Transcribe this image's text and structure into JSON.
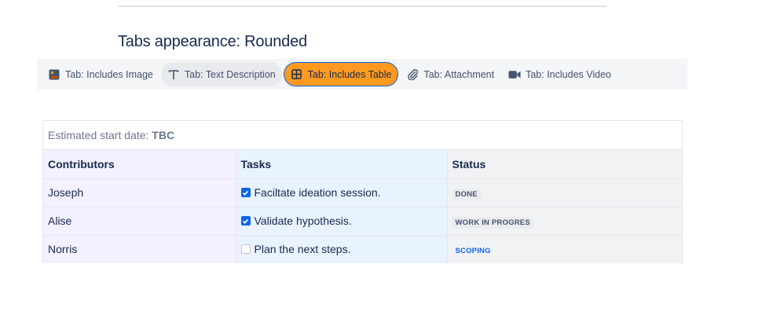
{
  "heading": "Tabs appearance: Rounded",
  "tabs": [
    {
      "label": "Tab: Includes Image",
      "icon": "image-icon"
    },
    {
      "label": "Tab: Text Description",
      "icon": "text-icon"
    },
    {
      "label": "Tab: Includes Table",
      "icon": "table-icon"
    },
    {
      "label": "Tab: Attachment",
      "icon": "paperclip-icon"
    },
    {
      "label": "Tab: Includes Video",
      "icon": "video-icon"
    }
  ],
  "active_tab": "Tab: Includes Table",
  "panel": {
    "start_label": "Estimated start date:",
    "start_value": "TBC",
    "headers": [
      "Contributors",
      "Tasks",
      "Status"
    ],
    "rows": [
      {
        "contributor": "Joseph",
        "task": "Faciltate ideation session.",
        "checked": true,
        "status": "DONE"
      },
      {
        "contributor": "Alise",
        "task": "Validate hypothesis.",
        "checked": true,
        "status": "WORK IN PROGRES"
      },
      {
        "contributor": "Norris",
        "task": "Plan the next steps.",
        "checked": false,
        "status": "SCOPING"
      }
    ]
  },
  "colors": {
    "active_tab_bg": "#ff991f",
    "active_tab_border": "#0c66e4",
    "contributors_col_bg": "#f3f0ff",
    "tasks_col_bg": "#e9f2ff",
    "status_col_bg": "#f1f2f4",
    "checkbox_on": "#0c66e4"
  }
}
